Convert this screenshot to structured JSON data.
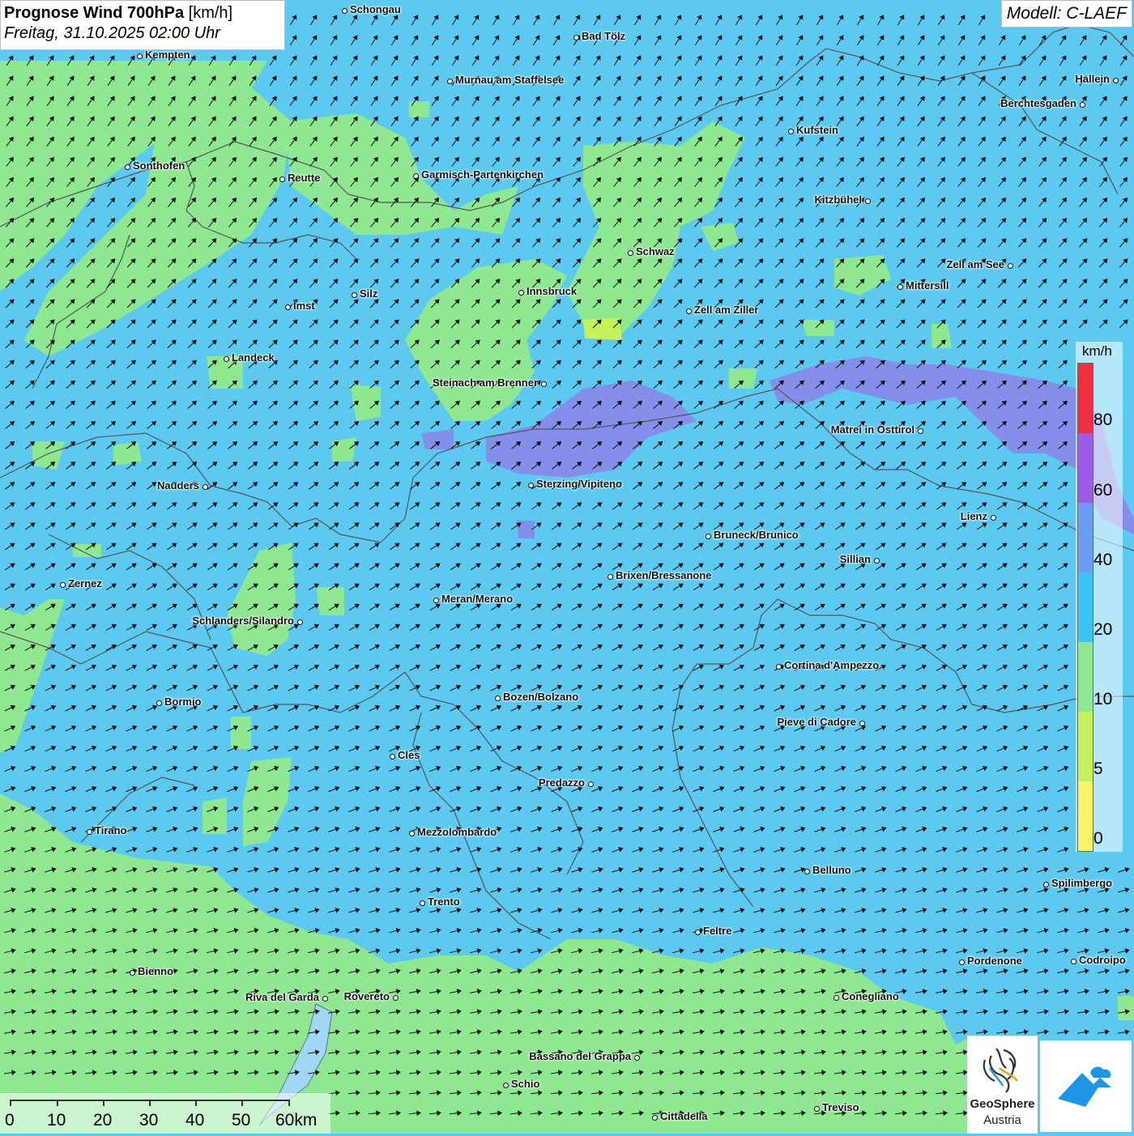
{
  "title": {
    "main_bold": "Prognose Wind 700hPa",
    "unit": "[km/h]",
    "date": "Freitag, 31.10.2025 02:00 Uhr"
  },
  "model": "Modell: C-LAEF",
  "legend": {
    "unit": "km/h",
    "ticks": [
      "80",
      "60",
      "40",
      "20",
      "10",
      "5",
      "0"
    ],
    "colors": [
      "#f03040",
      "#9b5be8",
      "#6a9ef2",
      "#3cc4f2",
      "#8de88f",
      "#c6f05a",
      "#fbf56a"
    ]
  },
  "scale": {
    "labels": [
      "0",
      "10",
      "20",
      "30",
      "40",
      "50",
      "60km"
    ]
  },
  "logo": {
    "name_line1": "GeoSphere",
    "name_line2": "Austria"
  },
  "colors": {
    "wind_10_20": "#8de88f",
    "wind_20_40": "#5ccaf0",
    "wind_40_60": "#8a85e8",
    "border": "#555555"
  },
  "cities": [
    {
      "name": "Schongau"
    },
    {
      "name": "Bad Tölz"
    },
    {
      "name": "Kempten"
    },
    {
      "name": "Murnau am Staffelsee"
    },
    {
      "name": "Hallein"
    },
    {
      "name": "Berchtesgaden"
    },
    {
      "name": "Kufstein"
    },
    {
      "name": "Sonthofen"
    },
    {
      "name": "Reutte"
    },
    {
      "name": "Garmisch-Partenkirchen"
    },
    {
      "name": "Kitzbühel"
    },
    {
      "name": "Schwaz"
    },
    {
      "name": "Zell am See"
    },
    {
      "name": "Innsbruck"
    },
    {
      "name": "Mittersill"
    },
    {
      "name": "Imst"
    },
    {
      "name": "Silz"
    },
    {
      "name": "Zell am Ziller"
    },
    {
      "name": "Landeck"
    },
    {
      "name": "Steinach am Brenner"
    },
    {
      "name": "Matrei in Osttirol"
    },
    {
      "name": "Nauders"
    },
    {
      "name": "Sterzing/Vipiteno"
    },
    {
      "name": "Lienz"
    },
    {
      "name": "Bruneck/Brunico"
    },
    {
      "name": "Sillian"
    },
    {
      "name": "Zernez"
    },
    {
      "name": "Brixen/Bressanone"
    },
    {
      "name": "Meran/Merano"
    },
    {
      "name": "Schlanders/Silandro"
    },
    {
      "name": "Cortina d'Ampezzo"
    },
    {
      "name": "Bormio"
    },
    {
      "name": "Bozen/Bolzano"
    },
    {
      "name": "Pieve di Cadore"
    },
    {
      "name": "Cles"
    },
    {
      "name": "Predazzo"
    },
    {
      "name": "Tirano"
    },
    {
      "name": "Mezzolombardo"
    },
    {
      "name": "Belluno"
    },
    {
      "name": "Spilimbergo"
    },
    {
      "name": "Trento"
    },
    {
      "name": "Feltre"
    },
    {
      "name": "Bienno"
    },
    {
      "name": "Pordenone"
    },
    {
      "name": "Codroipo"
    },
    {
      "name": "Riva del Garda"
    },
    {
      "name": "Rovereto"
    },
    {
      "name": "Conegliano"
    },
    {
      "name": "Bassano del Grappa"
    },
    {
      "name": "Schio"
    },
    {
      "name": "Treviso"
    },
    {
      "name": "Cittadella"
    }
  ]
}
